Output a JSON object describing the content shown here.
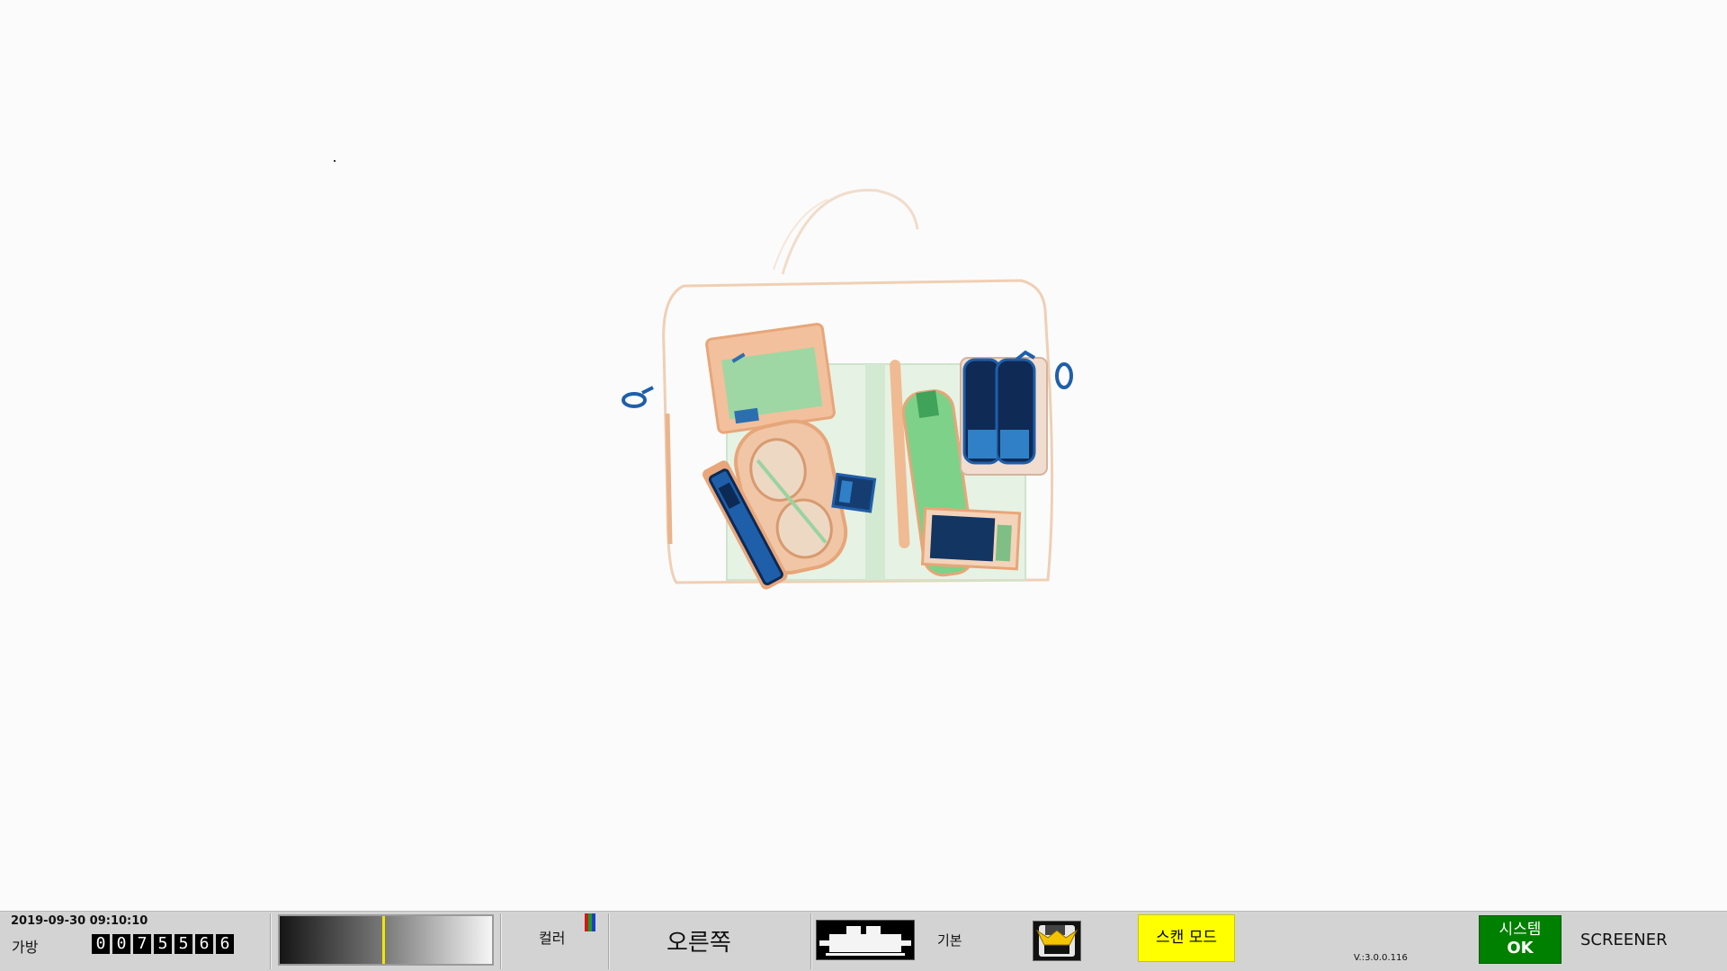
{
  "statusbar": {
    "datetime": "2019-09-30 09:10:10",
    "bag_label": "가방",
    "bag_count_digits": [
      "0",
      "0",
      "7",
      "5",
      "5",
      "6",
      "6"
    ],
    "gray_marker_level": 0.49,
    "color_label": "컬러",
    "color_bar_colors": [
      "#d11a1a",
      "#1c9a2a",
      "#1c3fc4"
    ],
    "direction": "오른쪽",
    "basic_label": "기본",
    "scan_mode": "스캔 모드",
    "version": "V.:3.0.0.116",
    "system_label": "시스템",
    "system_status": "OK",
    "user_role": "SCREENER"
  },
  "colors": {
    "scan_mode_bg": "#ffff00",
    "system_ok_bg": "#008000",
    "organic": "#e8a06c",
    "inorganic": "#8ed89c",
    "metal": "#1f5faa",
    "dense": "#0d2a55"
  },
  "icons": {
    "mode_button": "conveyor-belt-icon",
    "save_button": "floppy-save-icon"
  }
}
